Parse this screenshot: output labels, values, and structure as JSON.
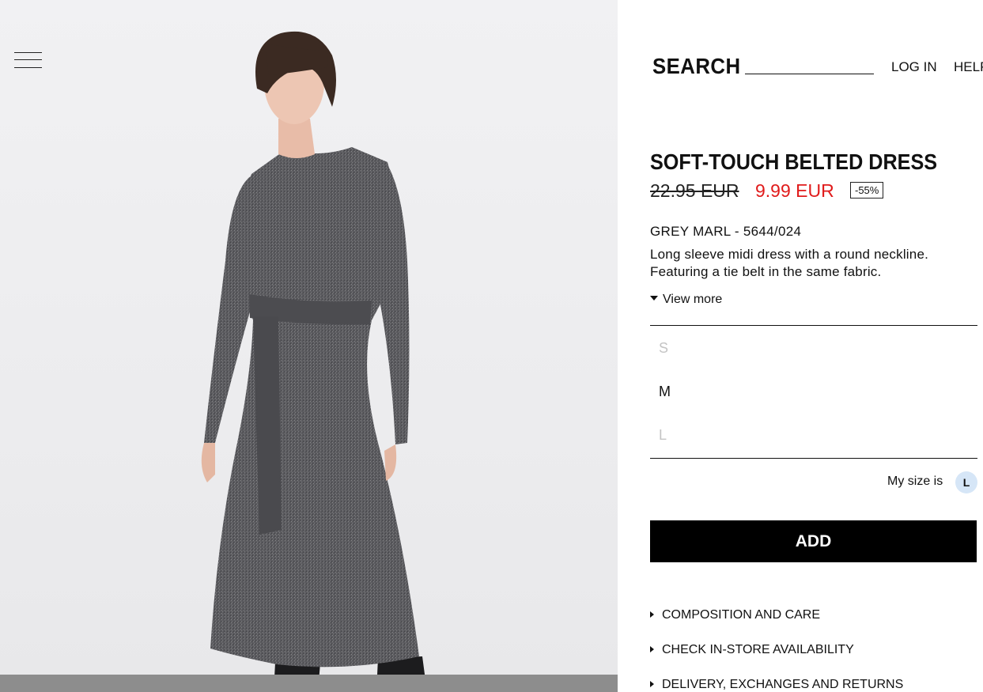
{
  "header": {
    "search_label": "SEARCH",
    "login_label": "LOG IN",
    "help_label": "HELP"
  },
  "product": {
    "title": "SOFT-TOUCH BELTED DRESS",
    "old_price": "22.95 EUR",
    "new_price": "9.99 EUR",
    "discount": "-55%",
    "color_ref": "GREY MARL - 5644/024",
    "description": "Long sleeve midi dress with a round neckline. Featuring a tie belt in the same fabric.",
    "view_more": "View more",
    "sale_color": "#e01b1b"
  },
  "sizes": [
    {
      "label": "S",
      "available": false
    },
    {
      "label": "M",
      "available": true
    },
    {
      "label": "L",
      "available": false
    }
  ],
  "my_size": {
    "label": "My size is",
    "value": "L"
  },
  "add_button": "ADD",
  "info_links": [
    "COMPOSITION AND CARE",
    "CHECK IN-STORE AVAILABILITY",
    "DELIVERY, EXCHANGES AND RETURNS"
  ]
}
